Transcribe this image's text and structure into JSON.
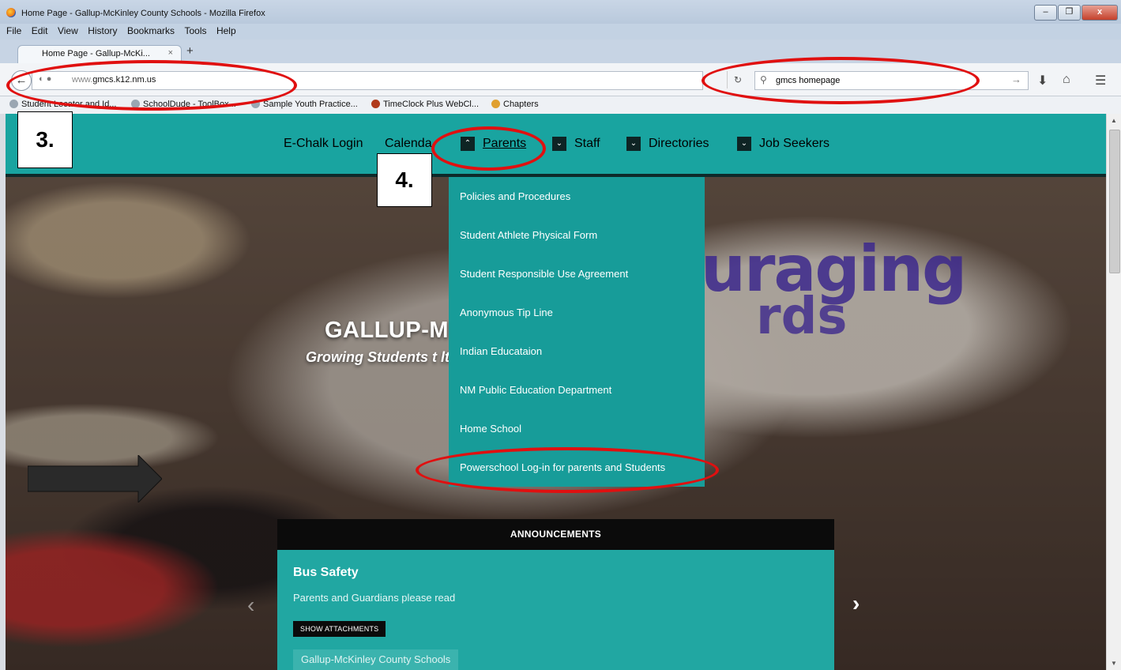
{
  "window": {
    "title": "Home Page - Gallup-McKinley County Schools - Mozilla Firefox",
    "controls": [
      "–",
      "❐",
      "x"
    ]
  },
  "menu": [
    "File",
    "Edit",
    "View",
    "History",
    "Bookmarks",
    "Tools",
    "Help"
  ],
  "tab": {
    "label": "Home Page - Gallup-McKi...",
    "close": "×",
    "new": "+"
  },
  "navbar": {
    "url_prefix": "www.",
    "url_domain": "gmcs.k12.nm.us",
    "search_value": "gmcs homepage"
  },
  "bookmarks": [
    "Student Locator and Id...",
    "SchoolDude - ToolBox...",
    "Sample Youth Practice...",
    "TimeClock Plus WebCl...",
    "Chapters"
  ],
  "site": {
    "nav": {
      "echalk": "E-Chalk Login",
      "calendar": "Calenda",
      "parents": "Parents",
      "staff": "Staff",
      "directories": "Directories",
      "job_seekers": "Job Seekers"
    },
    "hero_title": "GALLUP-M                               HOOLS",
    "hero_subtitle": "Growing Students t                                 ltural Society",
    "hero_scribble": "uraging",
    "hero_scribble2": "rds",
    "parents_menu": [
      "Policies and Procedures",
      "Student Athlete Physical Form",
      "Student Responsible Use Agreement",
      "Anonymous Tip Line",
      "Indian Educataion",
      "NM Public Education Department",
      "Home School",
      "Powerschool Log-in for parents and Students"
    ],
    "announcements": {
      "heading": "ANNOUNCEMENTS",
      "title": "Bus Safety",
      "text": "Parents and Guardians please read",
      "button": "SHOW ATTACHMENTS",
      "tag": "Gallup-McKinley County Schools"
    }
  },
  "annotations": {
    "step3": "3.",
    "step4": "4."
  },
  "colors": {
    "teal": "#19a4a0",
    "dropdown": "#179c99",
    "highlight": "#e01010"
  }
}
